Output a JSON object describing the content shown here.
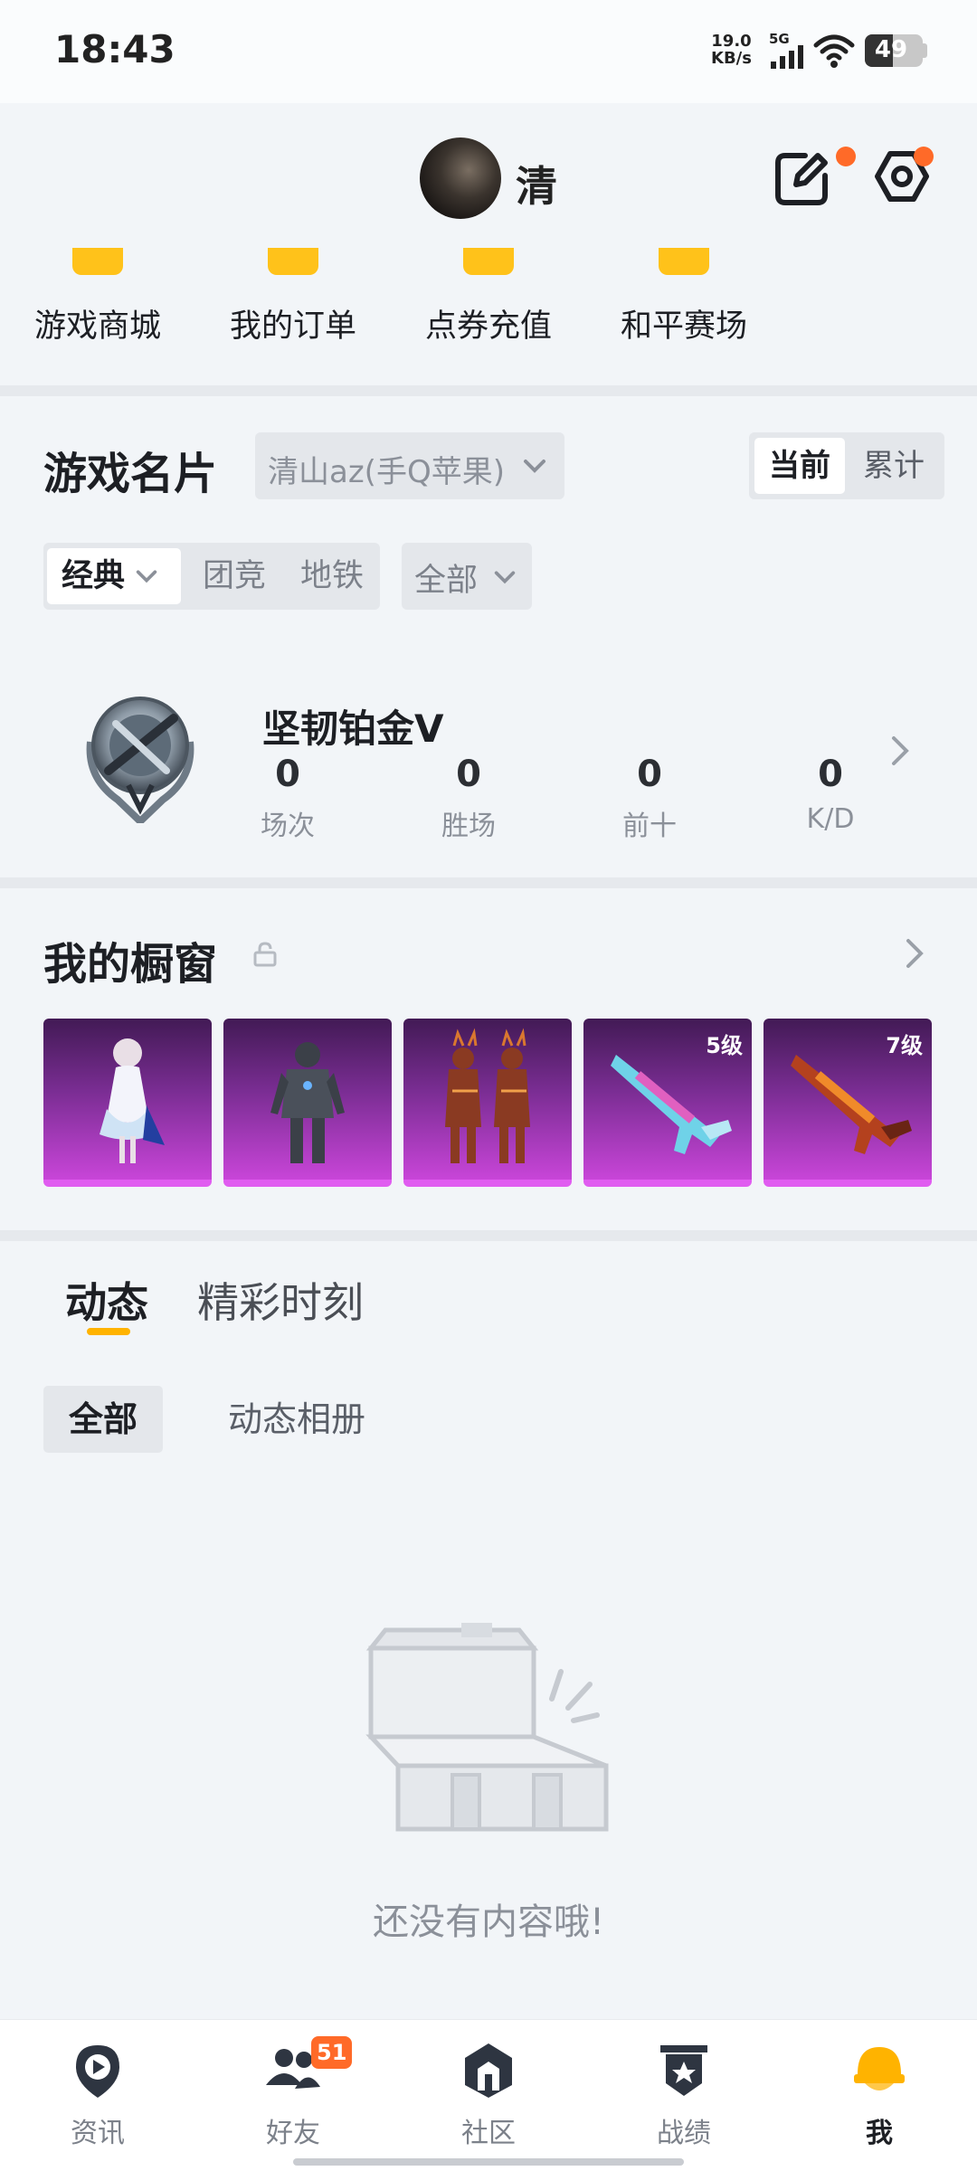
{
  "status_bar": {
    "time": "18:43",
    "net_speed_value": "19.0",
    "net_speed_unit": "KB/s",
    "network": "5G",
    "battery": "49",
    "battery_level": 0.49
  },
  "profile": {
    "name": "清",
    "edit_icon": "edit-icon",
    "settings_icon": "settings-hex-icon",
    "notification_dot_color": "#ff6a28"
  },
  "quick_actions": [
    {
      "label": "游戏商城"
    },
    {
      "label": "我的订单"
    },
    {
      "label": "点券充值"
    },
    {
      "label": "和平赛场"
    }
  ],
  "game_card": {
    "title": "游戏名片",
    "account": "清山az(手Q苹果)",
    "scope_tabs": [
      {
        "label": "当前",
        "active": true
      },
      {
        "label": "累计",
        "active": false
      }
    ],
    "mode_tabs": [
      {
        "label": "经典",
        "active": true
      },
      {
        "label": "团竞"
      },
      {
        "label": "地铁"
      }
    ],
    "filter": "全部",
    "rank": {
      "name": "坚韧铂金Ⅴ",
      "stats": [
        {
          "value": "0",
          "label": "场次"
        },
        {
          "value": "0",
          "label": "胜场"
        },
        {
          "value": "0",
          "label": "前十"
        },
        {
          "value": "0",
          "label": "K/D"
        }
      ]
    }
  },
  "showcase": {
    "title": "我的橱窗",
    "items": [
      {
        "kind": "character-outfit",
        "level": ""
      },
      {
        "kind": "armor-suit",
        "level": ""
      },
      {
        "kind": "twin-demon-outfit",
        "level": ""
      },
      {
        "kind": "rifle-skin",
        "level": "5级"
      },
      {
        "kind": "rifle-skin",
        "level": "7级"
      }
    ]
  },
  "feed": {
    "tabs": [
      {
        "label": "动态",
        "active": true
      },
      {
        "label": "精彩时刻",
        "active": false
      }
    ],
    "subtabs": [
      {
        "label": "全部",
        "active": true
      },
      {
        "label": "动态相册",
        "active": false
      }
    ],
    "empty_text": "还没有内容哦!"
  },
  "bottom_nav": [
    {
      "label": "资讯",
      "icon": "play-pin-icon",
      "badge": ""
    },
    {
      "label": "好友",
      "icon": "friends-icon",
      "badge": "51"
    },
    {
      "label": "社区",
      "icon": "community-icon",
      "badge": ""
    },
    {
      "label": "战绩",
      "icon": "record-shield-icon",
      "badge": ""
    },
    {
      "label": "我",
      "icon": "me-helmet-icon",
      "badge": "",
      "active": true
    }
  ],
  "colors": {
    "accent": "#ffb300",
    "badge": "#ff6a28",
    "showcase_purple": "#c845d8"
  }
}
